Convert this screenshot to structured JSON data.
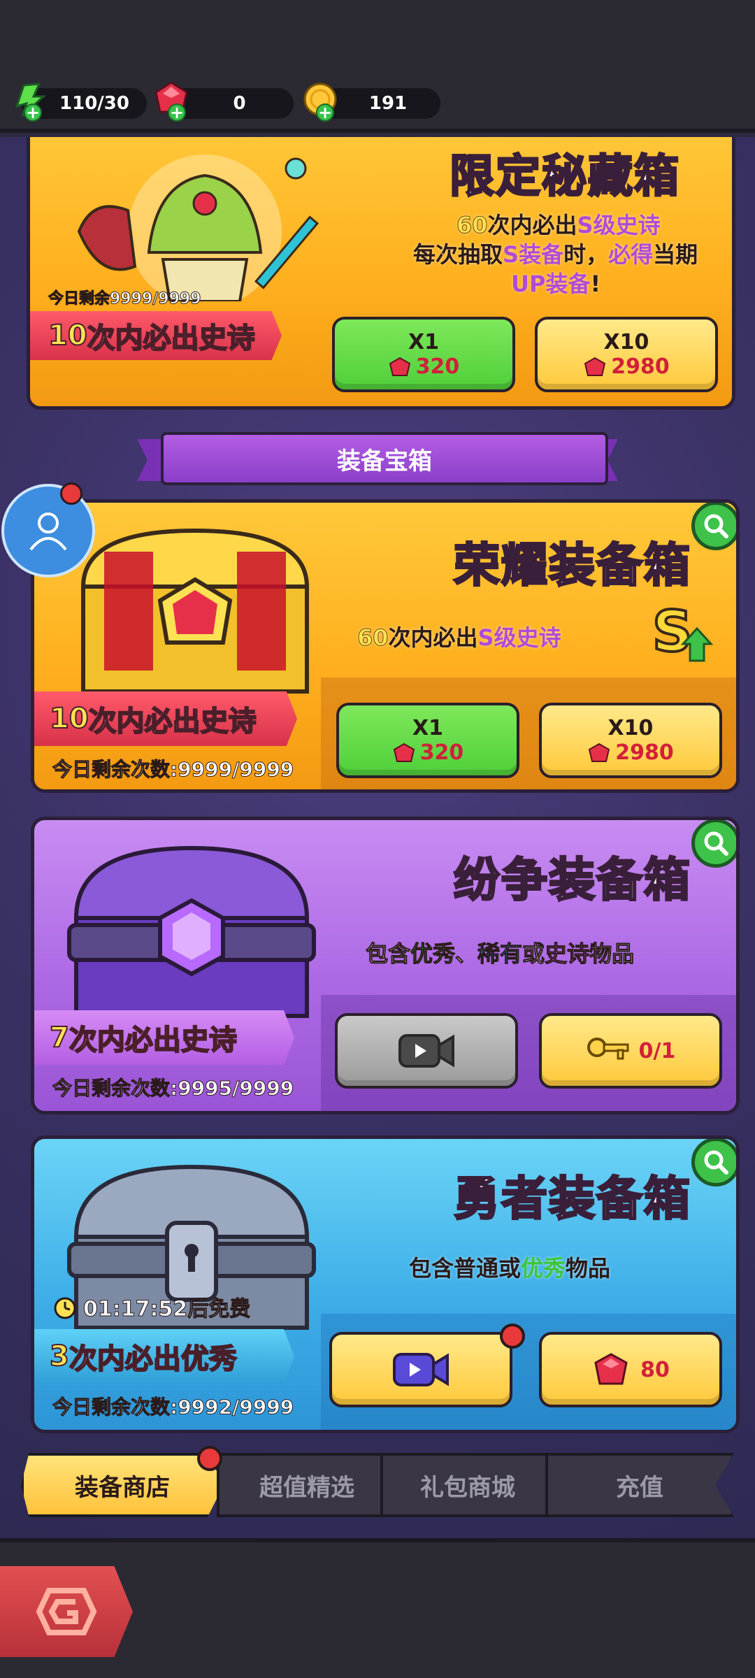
{
  "resources": {
    "stamina": "110/30",
    "gems": "0",
    "gold": "191"
  },
  "limited_box": {
    "title": "限定秘藏箱",
    "desc_line1_num": "60",
    "desc_line1_mid": "次内必出",
    "desc_line1_hl": "S级史诗",
    "desc_line2_pre": "每次抽取",
    "desc_line2_hl1": "S装备",
    "desc_line2_mid": "时，",
    "desc_line2_hl2": "必得",
    "desc_line2_post": "当期",
    "desc_line3_hl": "UP装备",
    "desc_line3_post": "!",
    "remaining": "今日剩余9999/9999",
    "ribbon_num": "10",
    "ribbon_mid": "次内必出",
    "ribbon_epic": "史诗",
    "btn1_mult": "X1",
    "btn1_price": "320",
    "btn2_mult": "X10",
    "btn2_price": "2980"
  },
  "section_title": "装备宝箱",
  "glory_box": {
    "title": "荣耀装备箱",
    "desc_num": "60",
    "desc_mid": "次内必出",
    "desc_hl": "S级史诗",
    "badge": "S",
    "ribbon_num": "10",
    "ribbon_mid": "次内必出",
    "ribbon_epic": "史诗",
    "remaining": "今日剩余次数:9999/9999",
    "btn1_mult": "X1",
    "btn1_price": "320",
    "btn2_mult": "X10",
    "btn2_price": "2980"
  },
  "dispute_box": {
    "title": "纷争装备箱",
    "desc_pre": "包含",
    "desc_hl1": "优秀",
    "desc_sep": "、",
    "desc_hl2": "稀有",
    "desc_or": "或",
    "desc_hl3": "史诗",
    "desc_post": "物品",
    "ribbon_num": "7",
    "ribbon_mid": "次内必出",
    "ribbon_epic": "史诗",
    "remaining": "今日剩余次数:9995/9999",
    "key_count": "0/1"
  },
  "brave_box": {
    "title": "勇者装备箱",
    "desc_pre": "包含普通或",
    "desc_hl": "优秀",
    "desc_post": "物品",
    "timer": "01:17:52后免费",
    "ribbon_num": "3",
    "ribbon_mid": "次内必出",
    "ribbon_good": "优秀",
    "remaining": "今日剩余次数:9992/9999",
    "price": "80"
  },
  "tabs": [
    "装备商店",
    "超值精选",
    "礼包商城",
    "充值"
  ],
  "colors": {
    "orange_panel": "#ffb01f",
    "purple_panel": "#ad69e4",
    "blue_panel": "#3daee8",
    "ruby": "#d21f3a"
  }
}
